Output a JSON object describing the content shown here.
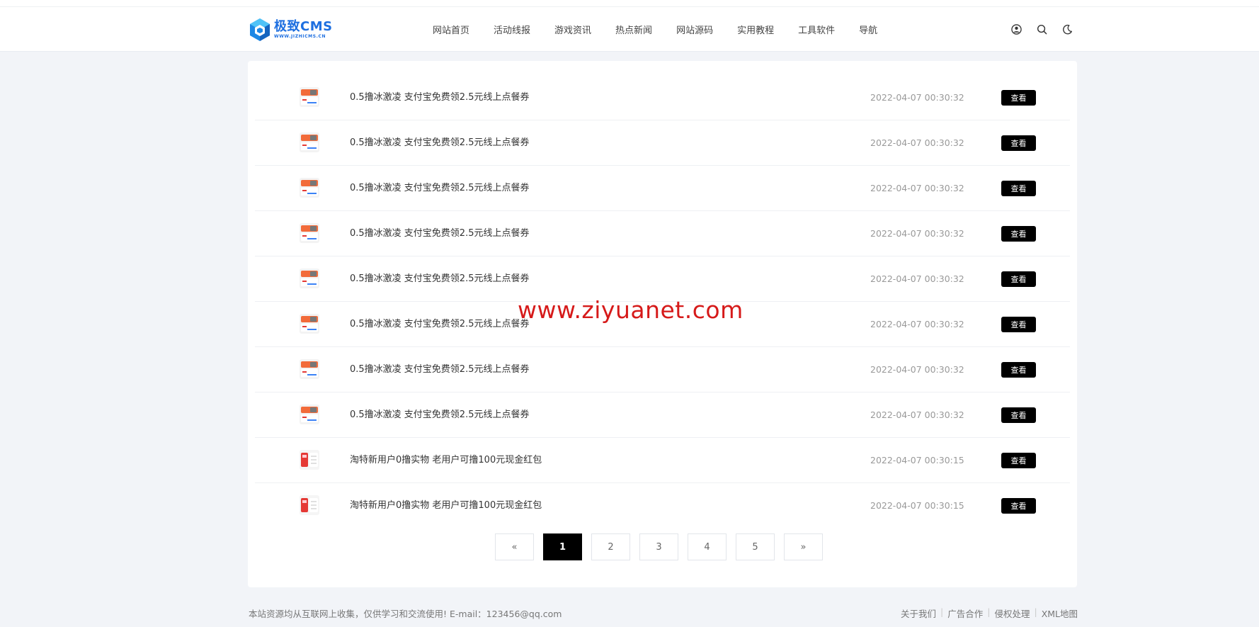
{
  "logo": {
    "name": "极致CMS",
    "sub": "WWW.JIZHICMS.CN"
  },
  "nav": [
    {
      "label": "网站首页"
    },
    {
      "label": "活动线报"
    },
    {
      "label": "游戏资讯"
    },
    {
      "label": "热点新闻"
    },
    {
      "label": "网站源码"
    },
    {
      "label": "实用教程"
    },
    {
      "label": "工具软件"
    },
    {
      "label": "导航"
    }
  ],
  "header_icons": [
    "user-circle-icon",
    "search-icon",
    "moon-icon"
  ],
  "list": [
    {
      "title": "0.5撸冰激凌 支付宝免费领2.5元线上点餐券",
      "time": "2022-04-07 00:30:32",
      "button": "查看",
      "thumb": "coupon-thumbnail"
    },
    {
      "title": "0.5撸冰激凌 支付宝免费领2.5元线上点餐券",
      "time": "2022-04-07 00:30:32",
      "button": "查看",
      "thumb": "coupon-thumbnail"
    },
    {
      "title": "0.5撸冰激凌 支付宝免费领2.5元线上点餐券",
      "time": "2022-04-07 00:30:32",
      "button": "查看",
      "thumb": "coupon-thumbnail"
    },
    {
      "title": "0.5撸冰激凌 支付宝免费领2.5元线上点餐券",
      "time": "2022-04-07 00:30:32",
      "button": "查看",
      "thumb": "coupon-thumbnail"
    },
    {
      "title": "0.5撸冰激凌 支付宝免费领2.5元线上点餐券",
      "time": "2022-04-07 00:30:32",
      "button": "查看",
      "thumb": "coupon-thumbnail"
    },
    {
      "title": "0.5撸冰激凌 支付宝免费领2.5元线上点餐券",
      "time": "2022-04-07 00:30:32",
      "button": "查看",
      "thumb": "coupon-thumbnail"
    },
    {
      "title": "0.5撸冰激凌 支付宝免费领2.5元线上点餐券",
      "time": "2022-04-07 00:30:32",
      "button": "查看",
      "thumb": "coupon-thumbnail"
    },
    {
      "title": "0.5撸冰激凌 支付宝免费领2.5元线上点餐券",
      "time": "2022-04-07 00:30:32",
      "button": "查看",
      "thumb": "coupon-thumbnail"
    },
    {
      "title": "淘特新用户0撸实物 老用户可撸100元现金红包",
      "time": "2022-04-07 00:30:15",
      "button": "查看",
      "thumb": "redpacket-thumbnail"
    },
    {
      "title": "淘特新用户0撸实物 老用户可撸100元现金红包",
      "time": "2022-04-07 00:30:15",
      "button": "查看",
      "thumb": "redpacket-thumbnail"
    }
  ],
  "pagination": {
    "prev": "«",
    "pages": [
      "1",
      "2",
      "3",
      "4",
      "5"
    ],
    "current": "1",
    "next": "»"
  },
  "watermark": "www.ziyuanet.com",
  "footer": {
    "notice": "本站资源均从互联网上收集，仅供学习和交流使用! E-mail：123456@qq.com",
    "links": [
      "关于我们",
      "广告合作",
      "侵权处理",
      "XML地图"
    ]
  },
  "colors": {
    "accent": "#1e6fe0",
    "button": "#000000",
    "watermark": "#d61a1a",
    "background": "#f2f4f8"
  }
}
